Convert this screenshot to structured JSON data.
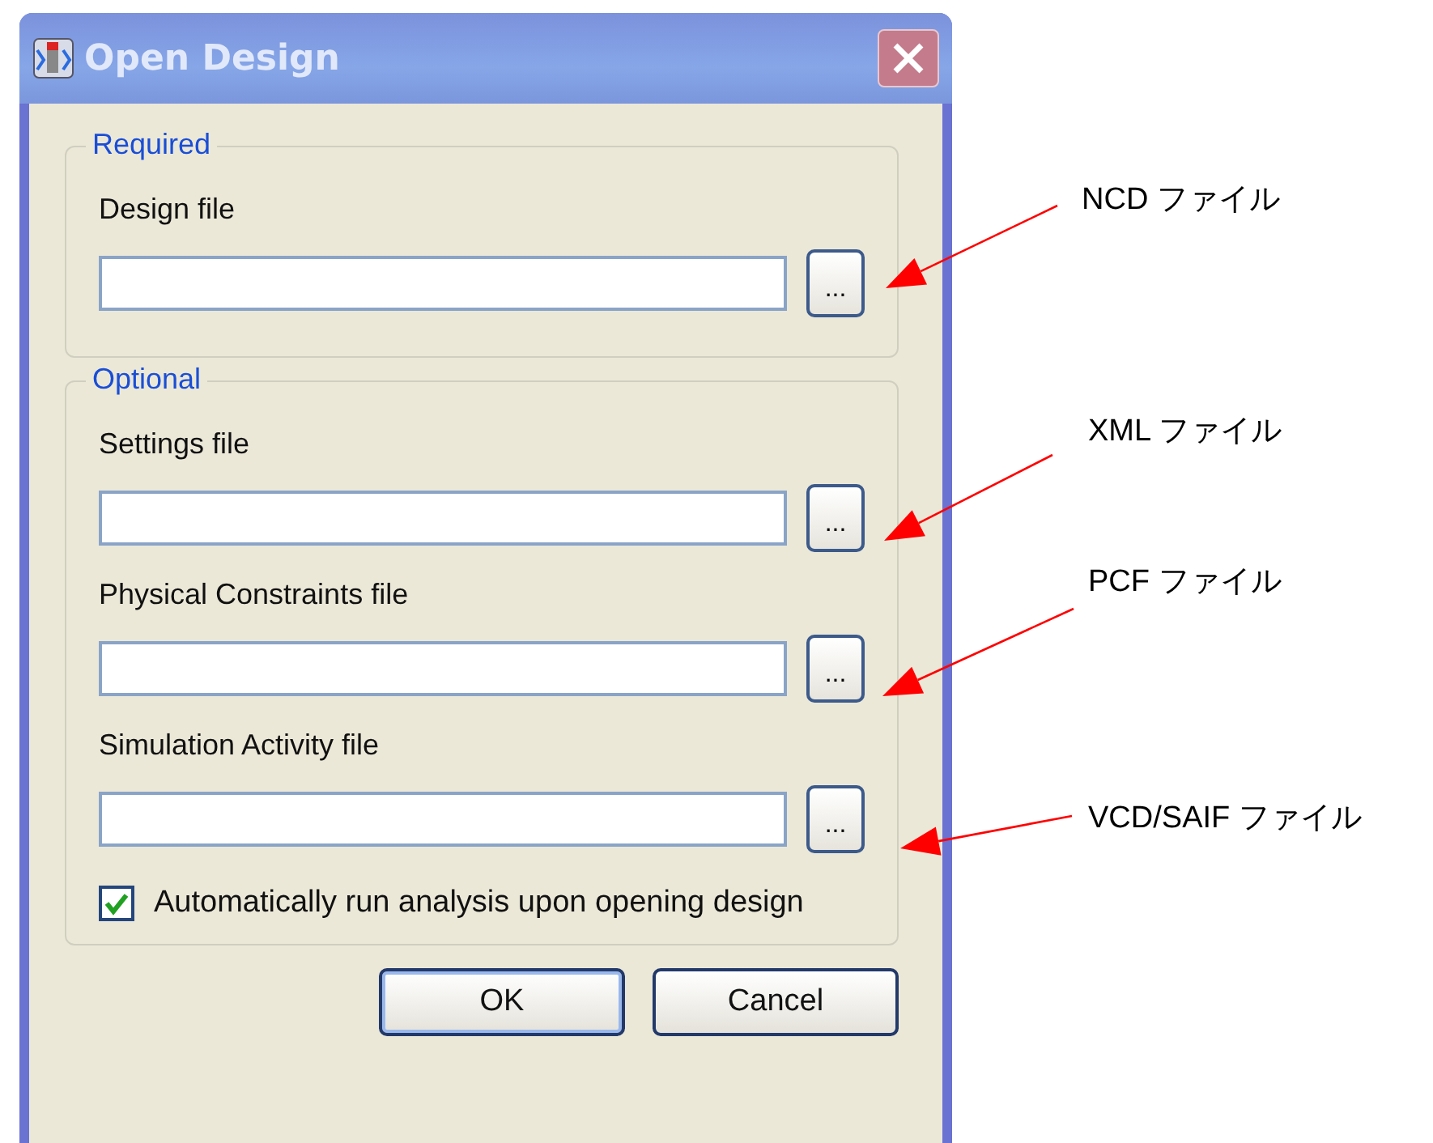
{
  "window": {
    "title": "Open Design"
  },
  "groups": [
    {
      "legend": "Required",
      "fields": [
        {
          "label": "Design file",
          "browse": "..."
        }
      ]
    },
    {
      "legend": "Optional",
      "fields": [
        {
          "label": "Settings file",
          "browse": "..."
        },
        {
          "label": "Physical Constraints file",
          "browse": "..."
        },
        {
          "label": "Simulation Activity file",
          "browse": "..."
        }
      ],
      "checkbox": {
        "label": "Automatically run analysis upon opening design",
        "checked": true
      }
    }
  ],
  "buttons": [
    {
      "label": "OK",
      "default": true
    },
    {
      "label": "Cancel",
      "default": false
    }
  ],
  "annotations": [
    {
      "text": "NCD ファイル"
    },
    {
      "text": "XML ファイル"
    },
    {
      "text": "PCF ファイル"
    },
    {
      "text": "VCD/SAIF ファイル"
    }
  ]
}
